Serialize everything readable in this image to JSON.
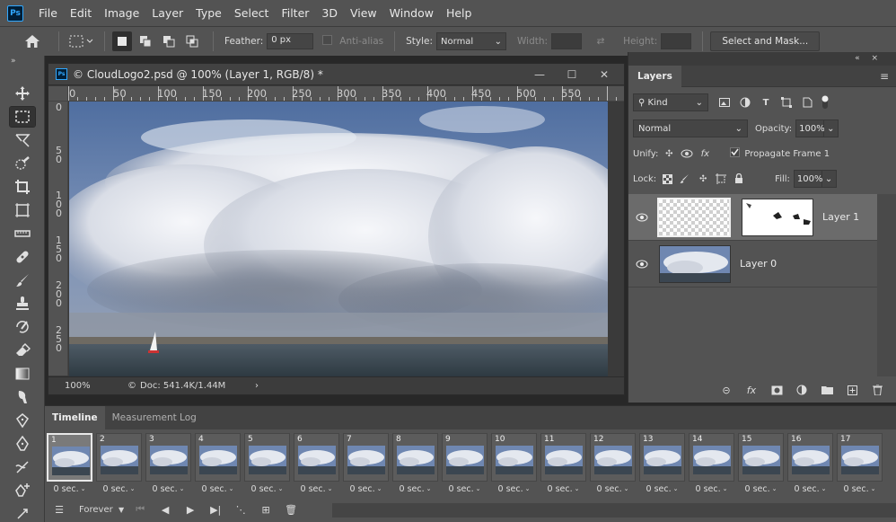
{
  "app": {
    "logo_text": "Ps",
    "accent": "#31a8ff"
  },
  "menu": [
    "File",
    "Edit",
    "Image",
    "Layer",
    "Type",
    "Select",
    "Filter",
    "3D",
    "View",
    "Window",
    "Help"
  ],
  "options": {
    "feather_label": "Feather:",
    "feather_value": "0 px",
    "antialias_label": "Anti-alias",
    "style_label": "Style:",
    "style_value": "Normal",
    "width_label": "Width:",
    "height_label": "Height:",
    "select_mask_label": "Select and Mask..."
  },
  "toolbar": {
    "collapse": "»",
    "tools": [
      "move-tool",
      "marquee-tool",
      "lasso-tool",
      "quick-select-tool",
      "crop-tool",
      "frame-tool",
      "ruler-tool",
      "healing-tool",
      "brush-tool",
      "stamp-tool",
      "history-brush-tool",
      "eraser-tool",
      "gradient-tool",
      "smudge-tool",
      "dodge-tool",
      "pen-tool",
      "freeform-pen-tool",
      "anchor-add-tool",
      "anchor-tool"
    ]
  },
  "document": {
    "title": "© CloudLogo2.psd @ 100% (Layer 1, RGB/8) *",
    "minimize": "—",
    "maximize": "☐",
    "close": "✕",
    "ruler_top": [
      "0",
      "50",
      "100",
      "150",
      "200",
      "250",
      "300",
      "350",
      "400",
      "450",
      "500",
      "550"
    ],
    "ruler_left": [
      "0",
      "5\n0",
      "1\n0\n0",
      "1\n5\n0",
      "2\n0\n0",
      "2\n5\n0"
    ],
    "zoom": "100%",
    "doc_info": "Doc: 541.4K/1.44M",
    "doc_info_prefix": "©",
    "status_arrow": "›"
  },
  "layers_panel": {
    "collapse": "«",
    "close": "×",
    "tab": "Layers",
    "menu_icon": "≡",
    "filter_kind": "Kind",
    "blend_mode": "Normal",
    "opacity_label": "Opacity:",
    "opacity_value": "100%",
    "unify_label": "Unify:",
    "propagate_label": "Propagate Frame 1",
    "lock_label": "Lock:",
    "fill_label": "Fill:",
    "fill_value": "100%",
    "layers": [
      {
        "name": "Layer 1",
        "selected": true,
        "has_mask": true
      },
      {
        "name": "Layer 0",
        "selected": false,
        "has_mask": false
      }
    ]
  },
  "timeline": {
    "tabs": [
      "Timeline",
      "Measurement Log"
    ],
    "frames": [
      {
        "num": "1",
        "delay": "0 sec."
      },
      {
        "num": "2",
        "delay": "0 sec."
      },
      {
        "num": "3",
        "delay": "0 sec."
      },
      {
        "num": "4",
        "delay": "0 sec."
      },
      {
        "num": "5",
        "delay": "0 sec."
      },
      {
        "num": "6",
        "delay": "0 sec."
      },
      {
        "num": "7",
        "delay": "0 sec."
      },
      {
        "num": "8",
        "delay": "0 sec."
      },
      {
        "num": "9",
        "delay": "0 sec."
      },
      {
        "num": "10",
        "delay": "0 sec."
      },
      {
        "num": "11",
        "delay": "0 sec."
      },
      {
        "num": "12",
        "delay": "0 sec."
      },
      {
        "num": "13",
        "delay": "0 sec."
      },
      {
        "num": "14",
        "delay": "0 sec."
      },
      {
        "num": "15",
        "delay": "0 sec."
      },
      {
        "num": "16",
        "delay": "0 sec."
      },
      {
        "num": "17",
        "delay": "0 sec."
      }
    ],
    "loop_value": "Forever"
  }
}
